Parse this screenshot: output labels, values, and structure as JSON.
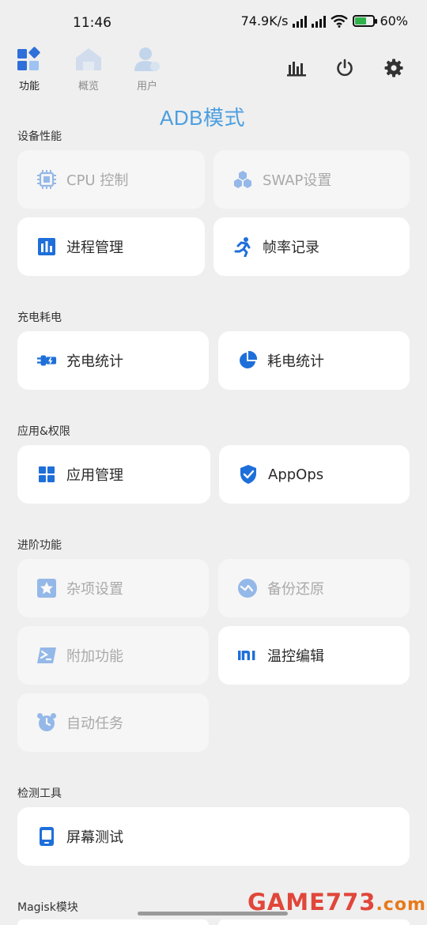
{
  "status_bar": {
    "time": "11:46",
    "net_speed": "74.9K/s",
    "battery": "60%",
    "battery_level": 0.6,
    "icons": [
      "signal-icon",
      "signal-icon",
      "wifi-icon",
      "battery-icon"
    ]
  },
  "nav": {
    "tabs": [
      {
        "label": "功能",
        "icon": "grid-diamond-icon",
        "active": true
      },
      {
        "label": "概览",
        "icon": "home-icon",
        "active": false
      },
      {
        "label": "用户",
        "icon": "user-icon",
        "active": false
      }
    ],
    "actions": [
      "bar-chart-icon",
      "power-icon",
      "gear-icon"
    ]
  },
  "mode_label": "ADB模式",
  "sections": [
    {
      "title": "设备性能",
      "items": [
        {
          "label": "CPU 控制",
          "icon": "chip-icon",
          "enabled": false
        },
        {
          "label": "SWAP设置",
          "icon": "hexagons-icon",
          "enabled": false
        },
        {
          "label": "进程管理",
          "icon": "bar-chart-box-icon",
          "enabled": true
        },
        {
          "label": "帧率记录",
          "icon": "running-person-icon",
          "enabled": true
        }
      ]
    },
    {
      "title": "充电耗电",
      "items": [
        {
          "label": "充电统计",
          "icon": "charger-plug-icon",
          "enabled": true
        },
        {
          "label": "耗电统计",
          "icon": "pie-chart-icon",
          "enabled": true
        }
      ]
    },
    {
      "title": "应用&权限",
      "items": [
        {
          "label": "应用管理",
          "icon": "four-squares-icon",
          "enabled": true
        },
        {
          "label": "AppOps",
          "icon": "shield-check-icon",
          "enabled": true
        }
      ]
    },
    {
      "title": "进阶功能",
      "items": [
        {
          "label": "杂项设置",
          "icon": "star-box-icon",
          "enabled": false
        },
        {
          "label": "备份还原",
          "icon": "backup-icon",
          "enabled": false
        },
        {
          "label": "附加功能",
          "icon": "terminal-icon",
          "enabled": false
        },
        {
          "label": "温控编辑",
          "icon": "mi-logo-icon",
          "enabled": true
        },
        {
          "label": "自动任务",
          "icon": "alarm-clock-icon",
          "enabled": false
        }
      ]
    },
    {
      "title": "检测工具",
      "items": [
        {
          "label": "屏幕测试",
          "icon": "phone-screen-icon",
          "enabled": true
        }
      ]
    },
    {
      "title": "Magisk模块",
      "items": []
    }
  ],
  "watermark": {
    "main": "GAME773",
    "suffix": ".com"
  },
  "colors": {
    "accent": "#1e6fd9",
    "mode_text": "#4c9fe0",
    "background": "#efefef",
    "card": "#ffffff",
    "card_disabled": "#f6f6f6"
  }
}
